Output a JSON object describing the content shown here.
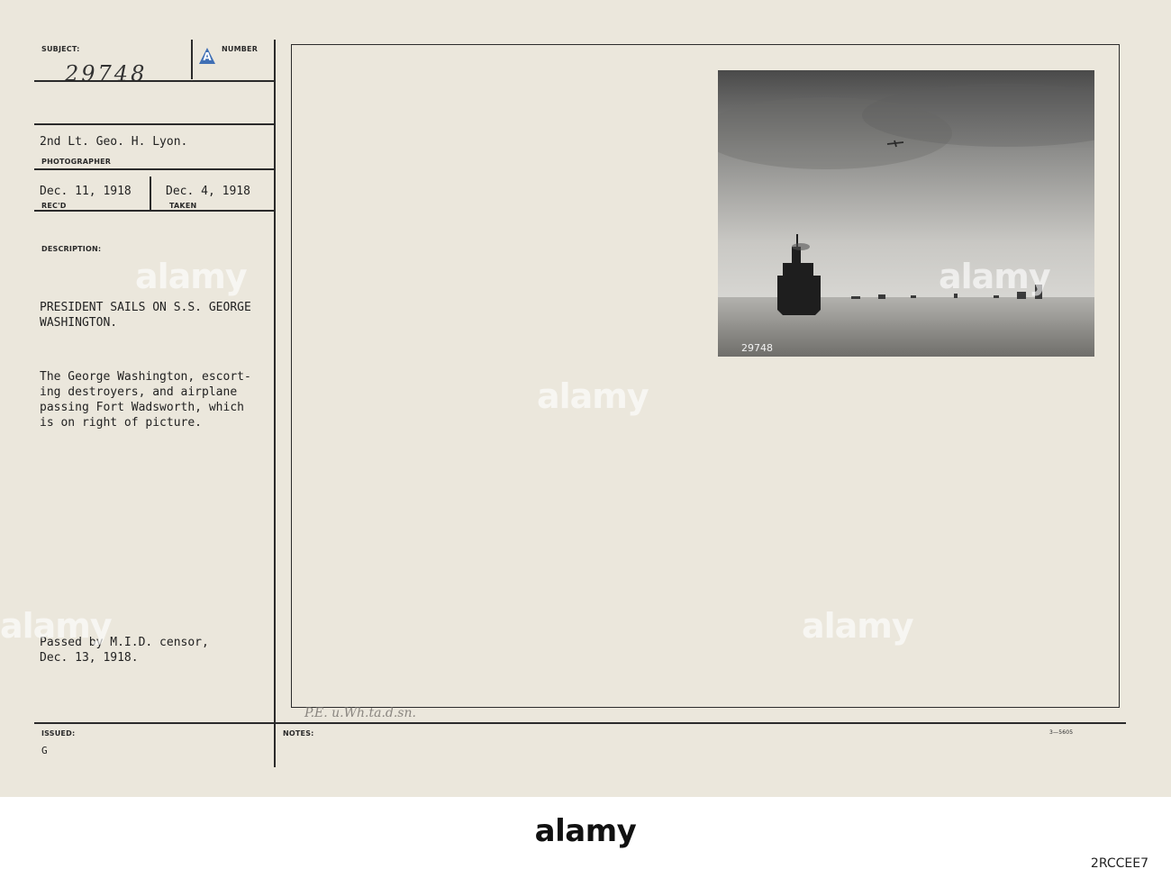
{
  "card": {
    "subject_label": "SUBJECT:",
    "subject_number": "29748",
    "series_letter": "A",
    "number_label": "NUMBER",
    "photographer_name": "2nd Lt. Geo. H. Lyon.",
    "photographer_label": "PHOTOGRAPHER",
    "received_date": "Dec. 11, 1918",
    "received_label": "REC'D",
    "taken_date": "Dec. 4, 1918",
    "taken_label": "TAKEN",
    "description_label": "DESCRIPTION:",
    "headline_line1": "PRESIDENT SAILS ON S.S. GEORGE",
    "headline_line2": "WASHINGTON.",
    "body_text": "The George Washington, escort-\ning destroyers, and airplane\npassing Fort Wadsworth, which\nis on right of picture.",
    "censor_line1": "Passed by M.I.D. censor,",
    "censor_line2": "Dec. 13, 1918.",
    "issued_label": "ISSUED:",
    "issued_value": "G",
    "notes_label": "NOTES:",
    "notes_handwritten": "P.E. u.Wh.ta.d.sn.",
    "form_number": "3—5605"
  },
  "photo": {
    "print_number": "29748"
  },
  "watermark": {
    "text": "alamy"
  },
  "footer": {
    "logo": "alamy",
    "image_id": "2RCCEE7"
  }
}
